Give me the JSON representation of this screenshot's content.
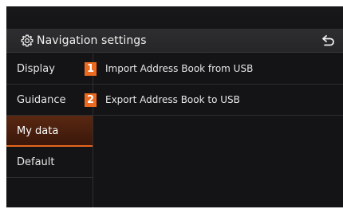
{
  "header": {
    "title": "Navigation settings",
    "settings_icon": "gear-icon",
    "back_icon": "back-arrow-icon"
  },
  "sidebar": {
    "items": [
      {
        "label": "Display",
        "selected": false
      },
      {
        "label": "Guidance",
        "selected": false
      },
      {
        "label": "My data",
        "selected": true
      },
      {
        "label": "Default",
        "selected": false
      }
    ]
  },
  "content": {
    "rows": [
      {
        "label": "Import Address Book from USB"
      },
      {
        "label": "Export Address Book to USB"
      }
    ]
  },
  "callouts": [
    "1",
    "2"
  ],
  "colors": {
    "accent": "#e3651e",
    "callout": "#ec6a1f",
    "background": "#141416",
    "header": "#2a2a2c"
  }
}
